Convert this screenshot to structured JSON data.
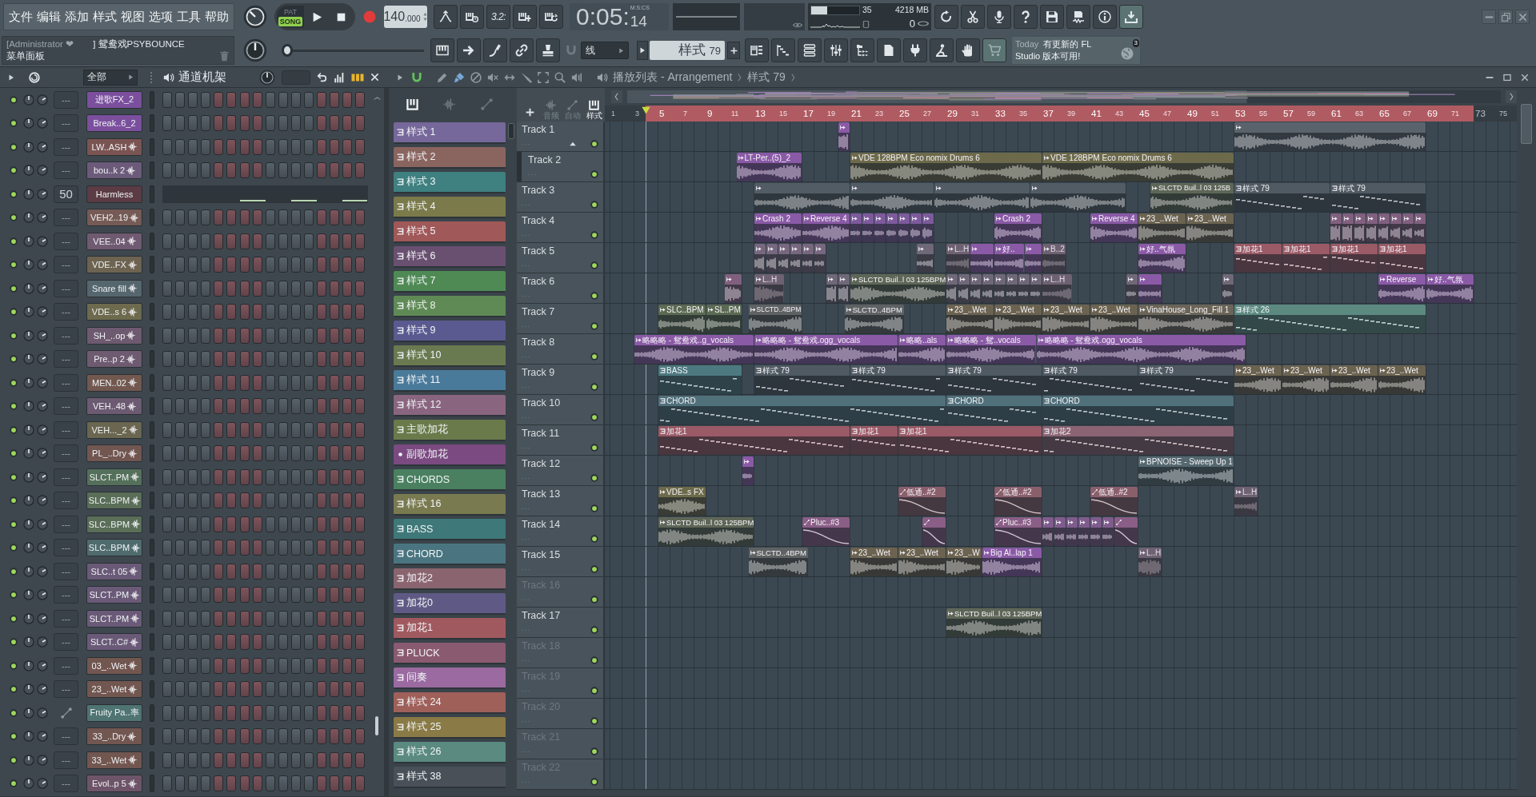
{
  "menu": [
    "文件",
    "编辑",
    "添加",
    "样式",
    "视图",
    "选项",
    "工具",
    "帮助"
  ],
  "hint": {
    "user": "[Administrator ❤",
    "project": "] 鸳鸯戏PSYBOUNCE",
    "panel": "菜单面板"
  },
  "transport": {
    "modes": [
      {
        "label": "PAT",
        "selected": false
      },
      {
        "label": "SONG",
        "selected": true
      }
    ],
    "tempo": "140",
    "tempo_decimals": ".000"
  },
  "toolbar": {
    "countdown": "3.2:"
  },
  "clock": {
    "label": "M:S:CS",
    "time": "0:05:",
    "centiseconds": "14"
  },
  "monitor": {
    "cpu": {
      "level": 0.33,
      "reading": "35"
    },
    "memory": "4218 MB",
    "polyphony": "0"
  },
  "master_pitch": {
    "level": 0
  },
  "snap": {
    "value": "线"
  },
  "pattern_selector": {
    "label": "样式",
    "number": "79"
  },
  "news": {
    "day": "Today",
    "lines": [
      "有更新的 FL",
      "Studio 版本可用!"
    ],
    "badge": "3"
  },
  "channel_rack": {
    "filter": "全部",
    "title": "通道机架",
    "channels": [
      {
        "name": "进歌FX_2",
        "kind": "plain",
        "color": "#7b4f9e",
        "mixer": "---",
        "on": true,
        "selected": false
      },
      {
        "name": "Break..6_2",
        "kind": "plain",
        "color": "#7b4f9e",
        "mixer": "---",
        "on": true,
        "selected": false
      },
      {
        "name": "LW..ASH",
        "kind": "sample",
        "color": "#7a5452",
        "mixer": "---",
        "on": true,
        "selected": false
      },
      {
        "name": "bou..k 2",
        "kind": "sample",
        "color": "#6c5a7a",
        "mixer": "---",
        "on": true,
        "selected": false
      },
      {
        "name": "Harmless",
        "kind": "instrument",
        "color": "#5b3b44",
        "mixer": "50",
        "on": true,
        "selected": false
      },
      {
        "name": "VEH2..19",
        "kind": "sample",
        "color": "#765a55",
        "mixer": "---",
        "on": true,
        "selected": false
      },
      {
        "name": "VEE..04",
        "kind": "sample",
        "color": "#705a72",
        "mixer": "---",
        "on": true,
        "selected": false
      },
      {
        "name": "VDE..FX",
        "kind": "sample",
        "color": "#6d6350",
        "mixer": "---",
        "on": true,
        "selected": false
      },
      {
        "name": "Snare fill",
        "kind": "sample",
        "color": "#56666e",
        "mixer": "---",
        "on": true,
        "selected": false
      },
      {
        "name": "VDE..s 6",
        "kind": "sample",
        "color": "#6d6a4e",
        "mixer": "---",
        "on": true,
        "selected": false
      },
      {
        "name": "SH_..op",
        "kind": "sample",
        "color": "#6e5a70",
        "mixer": "---",
        "on": true,
        "selected": false
      },
      {
        "name": "Pre..p 2",
        "kind": "sample",
        "color": "#6e5a71",
        "mixer": "---",
        "on": true,
        "selected": false
      },
      {
        "name": "MEN..02",
        "kind": "sample",
        "color": "#72584f",
        "mixer": "---",
        "on": true,
        "selected": false
      },
      {
        "name": "VEH..48",
        "kind": "sample",
        "color": "#6c5a72",
        "mixer": "---",
        "on": true,
        "selected": false
      },
      {
        "name": "VEH..._2",
        "kind": "sample",
        "color": "#6a6650",
        "mixer": "---",
        "on": true,
        "selected": false
      },
      {
        "name": "PL_..Dry",
        "kind": "sample",
        "color": "#725650",
        "mixer": "---",
        "on": true,
        "selected": false
      },
      {
        "name": "SLCT..PM",
        "kind": "sample",
        "color": "#55705a",
        "mixer": "---",
        "on": true,
        "selected": false
      },
      {
        "name": "SLC..BPM",
        "kind": "sample",
        "color": "#5a6e58",
        "mixer": "---",
        "on": true,
        "selected": false
      },
      {
        "name": "SLC..BPM",
        "kind": "sample",
        "color": "#5a6e58",
        "mixer": "---",
        "on": true,
        "selected": false
      },
      {
        "name": "SLC..BPM",
        "kind": "sample",
        "color": "#4f6b6e",
        "mixer": "---",
        "on": true,
        "selected": false
      },
      {
        "name": "SLC..t 05",
        "kind": "sample",
        "color": "#6a5a78",
        "mixer": "---",
        "on": true,
        "selected": false
      },
      {
        "name": "SLCT..PM",
        "kind": "sample",
        "color": "#6a5a78",
        "mixer": "---",
        "on": true,
        "selected": false
      },
      {
        "name": "SLCT..PM",
        "kind": "sample",
        "color": "#6a5a78",
        "mixer": "---",
        "on": true,
        "selected": false
      },
      {
        "name": "SLCT..C#",
        "kind": "sample",
        "color": "#6a5a78",
        "mixer": "---",
        "on": true,
        "selected": false
      },
      {
        "name": "03_..Wet",
        "kind": "sample",
        "color": "#725650",
        "mixer": "---",
        "on": true,
        "selected": false
      },
      {
        "name": "23_..Wet",
        "kind": "sample",
        "color": "#725650",
        "mixer": "---",
        "on": true,
        "selected": false
      },
      {
        "name": "Fruity Pa..率",
        "kind": "automation",
        "color": "#4f7472",
        "on": true,
        "selected": false
      },
      {
        "name": "33_..Dry",
        "kind": "sample",
        "color": "#725650",
        "mixer": "---",
        "on": true,
        "selected": false
      },
      {
        "name": "33_..Wet",
        "kind": "sample",
        "color": "#725650",
        "mixer": "---",
        "on": true,
        "selected": false
      },
      {
        "name": "Evol..p 5",
        "kind": "sample",
        "color": "#6e5468",
        "mixer": "---",
        "on": true,
        "selected": false
      }
    ]
  },
  "playlist": {
    "title": "播放列表 - Arrangement",
    "pattern": "样式 79",
    "picker_tabs": [
      {
        "kind": "keys",
        "selected": true
      },
      {
        "kind": "wave",
        "selected": false
      },
      {
        "kind": "curve",
        "selected": false
      }
    ],
    "patterns": [
      {
        "name": "样式 1",
        "kind": "notes",
        "color": "#76689a",
        "selected": false
      },
      {
        "name": "样式 2",
        "kind": "notes",
        "color": "#8a6560",
        "selected": false
      },
      {
        "name": "样式 3",
        "kind": "notes",
        "color": "#3f8080",
        "selected": false
      },
      {
        "name": "样式 4",
        "kind": "notes",
        "color": "#7a7a4a",
        "selected": false
      },
      {
        "name": "样式 5",
        "kind": "notes",
        "color": "#a05858",
        "selected": false
      },
      {
        "name": "样式 6",
        "kind": "notes",
        "color": "#6a5070",
        "selected": false
      },
      {
        "name": "样式 7",
        "kind": "notes",
        "color": "#4f8a55",
        "selected": false
      },
      {
        "name": "样式 8",
        "kind": "notes",
        "color": "#5f8a55",
        "selected": false
      },
      {
        "name": "样式 9",
        "kind": "notes",
        "color": "#5a5a90",
        "selected": false
      },
      {
        "name": "样式 10",
        "kind": "notes",
        "color": "#6a7a50",
        "selected": false
      },
      {
        "name": "样式 11",
        "kind": "notes",
        "color": "#4a7a9a",
        "selected": false
      },
      {
        "name": "样式 12",
        "kind": "notes",
        "color": "#8a6580",
        "selected": false
      },
      {
        "name": "主歌加花",
        "kind": "notes",
        "color": "#6a7a4a",
        "selected": false
      },
      {
        "name": "副歌加花",
        "kind": "dot",
        "color": "#7a4a80",
        "selected": false
      },
      {
        "name": "CHORDS",
        "kind": "notes",
        "color": "#4a8060",
        "selected": false
      },
      {
        "name": "样式 16",
        "kind": "notes",
        "color": "#7a7a50",
        "selected": false
      },
      {
        "name": "BASS",
        "kind": "notes",
        "color": "#3f7878",
        "selected": false
      },
      {
        "name": "CHORD",
        "kind": "notes",
        "color": "#4a7580",
        "selected": false
      },
      {
        "name": "加花2",
        "kind": "notes",
        "color": "#8a6570",
        "selected": false
      },
      {
        "name": "加花0",
        "kind": "notes",
        "color": "#5f5a85",
        "selected": false
      },
      {
        "name": "加花1",
        "kind": "notes",
        "color": "#a05a5f",
        "selected": false
      },
      {
        "name": "PLUCK",
        "kind": "notes",
        "color": "#8a5a70",
        "selected": false
      },
      {
        "name": "间奏",
        "kind": "notes",
        "color": "#9a6aa0",
        "selected": false
      },
      {
        "name": "样式 24",
        "kind": "notes",
        "color": "#a0605a",
        "selected": false
      },
      {
        "name": "样式 25",
        "kind": "notes",
        "color": "#8a7a45",
        "selected": false
      },
      {
        "name": "样式 26",
        "kind": "notes",
        "color": "#5a8a80",
        "selected": false
      },
      {
        "name": "样式 38",
        "kind": "notes",
        "color": "#4a5058",
        "selected": false
      }
    ],
    "clip_filters": [
      {
        "kind": "wave",
        "label": "音频",
        "selected": false
      },
      {
        "kind": "curve",
        "label": "自动",
        "selected": false
      },
      {
        "kind": "keys",
        "label": "样式",
        "selected": true
      }
    ],
    "ruler": {
      "bars": [
        "1",
        "3",
        "5",
        "7",
        "9",
        "11",
        "13",
        "15",
        "17",
        "19",
        "21",
        "23",
        "25",
        "27",
        "29",
        "31",
        "33",
        "35",
        "37",
        "39",
        "41",
        "43",
        "45",
        "47",
        "49",
        "51",
        "53",
        "55",
        "57",
        "59",
        "61",
        "63",
        "65",
        "67",
        "69",
        "71",
        "73",
        "75"
      ]
    },
    "tracks": [
      {
        "name": "Track 1",
        "on": true,
        "selected": false,
        "clips": [
          {
            "kind": "audio",
            "color": "#8a5aa6",
            "muted": false
          },
          {
            "kind": "audio",
            "color": "#5a636b",
            "muted": false
          }
        ]
      },
      {
        "name": "Track 2",
        "on": true,
        "selected": true,
        "clips": [
          {
            "kind": "audio",
            "name": "LT-Per..(5)_2",
            "color": "#8a5aa6",
            "muted": false
          },
          {
            "kind": "audio",
            "name": "VDE 128BPM Eco nomix Drums 6",
            "color": "#6d6a4b",
            "muted": false
          },
          {
            "kind": "audio",
            "name": "VDE 128BPM Eco nomix Drums 6",
            "color": "#6d6a4b",
            "muted": false
          }
        ]
      },
      {
        "name": "Track 3",
        "on": true,
        "selected": false,
        "clips": [
          {
            "kind": "audio",
            "color": "#525c64",
            "muted": false
          },
          {
            "kind": "audio",
            "color": "#525c64",
            "muted": false
          },
          {
            "kind": "audio",
            "color": "#525c64",
            "muted": false
          },
          {
            "kind": "audio",
            "color": "#525c64",
            "muted": false
          },
          {
            "kind": "audio",
            "name": "SLCTD Buil..l 03 125B",
            "color": "#5e6657",
            "muted": false
          },
          {
            "kind": "pattern",
            "name": "样式 79",
            "color": "#4f5a62",
            "muted": false
          },
          {
            "kind": "pattern",
            "name": "样式 79",
            "color": "#4f5a62",
            "muted": false
          }
        ]
      },
      {
        "name": "Track 4",
        "on": true,
        "selected": false,
        "clips": [
          {
            "kind": "audio",
            "name": "Crash 2",
            "color": "#8a5aa6",
            "muted": false
          },
          {
            "kind": "audio",
            "name": "Reverse 4",
            "color": "#8a5aa6",
            "muted": false
          },
          {
            "kind": "audio",
            "color": "#7d5a9c",
            "muted": false
          },
          {
            "kind": "audio",
            "color": "#7d5a9c",
            "muted": false
          },
          {
            "kind": "audio",
            "color": "#7d5a9c",
            "muted": false
          },
          {
            "kind": "audio",
            "color": "#7d5a9c",
            "muted": false
          },
          {
            "kind": "audio",
            "color": "#7d5a9c",
            "muted": false
          },
          {
            "kind": "audio",
            "color": "#7d5a9c",
            "muted": false
          },
          {
            "kind": "audio",
            "color": "#7d5a9c",
            "muted": false
          },
          {
            "kind": "audio",
            "name": "Crash 2",
            "color": "#8a5aa6",
            "muted": false
          },
          {
            "kind": "audio",
            "name": "Reverse 4",
            "color": "#8a5aa6",
            "muted": false
          },
          {
            "kind": "audio",
            "name": "23_..Wet",
            "color": "#6b6350",
            "muted": false
          },
          {
            "kind": "audio",
            "name": "23_..Wet",
            "color": "#6b6350",
            "muted": false
          },
          {
            "kind": "audio",
            "color": "#80607e",
            "muted": false
          },
          {
            "kind": "audio",
            "color": "#80607e",
            "muted": false
          },
          {
            "kind": "audio",
            "color": "#80607e",
            "muted": false
          },
          {
            "kind": "audio",
            "color": "#80607e",
            "muted": false
          },
          {
            "kind": "audio",
            "color": "#80607e",
            "muted": false
          },
          {
            "kind": "audio",
            "color": "#80607e",
            "muted": false
          },
          {
            "kind": "audio",
            "color": "#80607e",
            "muted": false
          },
          {
            "kind": "audio",
            "color": "#80607e",
            "muted": false
          }
        ]
      },
      {
        "name": "Track 5",
        "on": true,
        "selected": false,
        "clips": [
          {
            "kind": "audio",
            "color": "#77687f",
            "muted": false
          },
          {
            "kind": "audio",
            "color": "#77687f",
            "muted": false
          },
          {
            "kind": "audio",
            "color": "#77687f",
            "muted": false
          },
          {
            "kind": "audio",
            "color": "#77687f",
            "muted": false
          },
          {
            "kind": "audio",
            "color": "#77687f",
            "muted": false
          },
          {
            "kind": "audio",
            "color": "#77687f",
            "muted": false
          },
          {
            "kind": "audio",
            "color": "#6f6878",
            "muted": false
          },
          {
            "kind": "audio",
            "name": "L..H",
            "color": "#6e6272",
            "muted": true
          },
          {
            "kind": "audio",
            "color": "#8a5aa6",
            "muted": false
          },
          {
            "kind": "audio",
            "name": "好..",
            "color": "#8a5aa6",
            "muted": false
          },
          {
            "kind": "audio",
            "color": "#8a5aa6",
            "muted": false
          },
          {
            "kind": "audio",
            "name": "B..2",
            "color": "#6e6272",
            "muted": true
          },
          {
            "kind": "audio",
            "name": "好..气氛",
            "color": "#8a5aa6",
            "muted": false
          },
          {
            "kind": "pattern",
            "name": "加花1",
            "color": "#9a5a66",
            "muted": false
          },
          {
            "kind": "pattern",
            "name": "加花1",
            "color": "#9a5a66",
            "muted": false
          },
          {
            "kind": "pattern",
            "name": "加花1",
            "color": "#9a5a66",
            "muted": false
          },
          {
            "kind": "pattern",
            "name": "加花1",
            "color": "#9a5a66",
            "muted": false
          }
        ]
      },
      {
        "name": "Track 6",
        "on": true,
        "selected": false,
        "clips": [
          {
            "kind": "audio",
            "color": "#80607e",
            "muted": false
          },
          {
            "kind": "audio",
            "name": "L..H",
            "color": "#6e6272",
            "muted": true
          },
          {
            "kind": "audio",
            "color": "#6f6878",
            "muted": false
          },
          {
            "kind": "audio",
            "color": "#6f6878",
            "muted": false
          },
          {
            "kind": "audio",
            "name": "SLCTD Buil..l 03 125BPM",
            "color": "#5e6657",
            "muted": false
          },
          {
            "kind": "audio",
            "color": "#6f6878",
            "muted": false
          },
          {
            "kind": "audio",
            "color": "#6f6878",
            "muted": false
          },
          {
            "kind": "audio",
            "color": "#6f6878",
            "muted": false
          },
          {
            "kind": "audio",
            "color": "#6f6878",
            "muted": false
          },
          {
            "kind": "audio",
            "color": "#6f6878",
            "muted": false
          },
          {
            "kind": "audio",
            "color": "#6f6878",
            "muted": false
          },
          {
            "kind": "audio",
            "color": "#6f6878",
            "muted": false
          },
          {
            "kind": "audio",
            "color": "#6f6878",
            "muted": false
          },
          {
            "kind": "audio",
            "name": "L..H",
            "color": "#6e6272",
            "muted": true
          },
          {
            "kind": "audio",
            "color": "#6f6878",
            "muted": false
          },
          {
            "kind": "audio",
            "color": "#8a5aa6",
            "muted": false
          },
          {
            "kind": "audio",
            "color": "#6f6878",
            "muted": false
          },
          {
            "kind": "audio",
            "name": "Reverse",
            "color": "#8a5aa6",
            "muted": false
          },
          {
            "kind": "audio",
            "name": "好..气氛",
            "color": "#8a5aa6",
            "muted": false
          }
        ]
      },
      {
        "name": "Track 7",
        "on": true,
        "selected": false,
        "clips": [
          {
            "kind": "audio",
            "name": "SLC..BPM",
            "color": "#5b6a52",
            "muted": false
          },
          {
            "kind": "audio",
            "name": "SL..PM",
            "color": "#5b6a52",
            "muted": false
          },
          {
            "kind": "audio",
            "name": "SLCTD..4BPM",
            "color": "#5f6262",
            "muted": false
          },
          {
            "kind": "audio",
            "name": "SLCTD..4BPM",
            "color": "#5f6262",
            "muted": false
          },
          {
            "kind": "audio",
            "name": "23_..Wet",
            "color": "#6b6350",
            "muted": false
          },
          {
            "kind": "audio",
            "name": "23_..Wet",
            "color": "#6b6350",
            "muted": false
          },
          {
            "kind": "audio",
            "name": "23_..Wet",
            "color": "#6b6350",
            "muted": false
          },
          {
            "kind": "audio",
            "name": "23_..Wet",
            "color": "#6b6350",
            "muted": false
          },
          {
            "kind": "audio",
            "name": "VinaHouse_Long_Fill 1",
            "color": "#6b6558",
            "muted": false
          },
          {
            "kind": "pattern",
            "name": "样式 26",
            "color": "#5c8a80",
            "muted": false
          }
        ]
      },
      {
        "name": "Track 8",
        "on": true,
        "selected": false,
        "clips": [
          {
            "kind": "audio",
            "name": "略略略 - 鸳鸯戏..g_vocals",
            "color": "#8a5aa6",
            "muted": false
          },
          {
            "kind": "audio",
            "name": "略略略 - 鸳鸯戏.ogg_vocals",
            "color": "#8a5aa6",
            "muted": false
          },
          {
            "kind": "audio",
            "name": "略略..als",
            "color": "#8a5aa6",
            "muted": false
          },
          {
            "kind": "audio",
            "name": "略略略 - 鸳..vocals",
            "color": "#8a5aa6",
            "muted": false
          },
          {
            "kind": "audio",
            "name": "略略略 - 鸳鸯戏.ogg_vocals",
            "color": "#8a5aa6",
            "muted": false
          }
        ]
      },
      {
        "name": "Track 9",
        "on": true,
        "selected": false,
        "clips": [
          {
            "kind": "pattern",
            "name": "BASS",
            "color": "#4c7a80",
            "muted": false
          },
          {
            "kind": "pattern",
            "name": "样式 79",
            "color": "#4f5a62",
            "muted": false
          },
          {
            "kind": "pattern",
            "name": "样式 79",
            "color": "#4f5a62",
            "muted": false
          },
          {
            "kind": "pattern",
            "name": "样式 79",
            "color": "#4f5a62",
            "muted": false
          },
          {
            "kind": "pattern",
            "name": "样式 79",
            "color": "#4f5a62",
            "muted": false
          },
          {
            "kind": "pattern",
            "name": "样式 79",
            "color": "#4f5a62",
            "muted": false
          },
          {
            "kind": "audio",
            "name": "23_..Wet",
            "color": "#6b6350",
            "muted": false
          },
          {
            "kind": "audio",
            "name": "23_..Wet",
            "color": "#6b6350",
            "muted": false
          },
          {
            "kind": "audio",
            "name": "23_..Wet",
            "color": "#6b6350",
            "muted": false
          },
          {
            "kind": "audio",
            "name": "23_..Wet",
            "color": "#6b6350",
            "muted": false
          }
        ]
      },
      {
        "name": "Track 10",
        "on": true,
        "selected": false,
        "clips": [
          {
            "kind": "pattern",
            "name": "CHORD",
            "color": "#50707a",
            "muted": false
          },
          {
            "kind": "pattern",
            "name": "CHORD",
            "color": "#50707a",
            "muted": false
          },
          {
            "kind": "pattern",
            "name": "CHORD",
            "color": "#50707a",
            "muted": false
          }
        ]
      },
      {
        "name": "Track 11",
        "on": true,
        "selected": false,
        "clips": [
          {
            "kind": "pattern",
            "name": "加花1",
            "color": "#9a5a66",
            "muted": false
          },
          {
            "kind": "pattern",
            "name": "加花1",
            "color": "#9a5a66",
            "muted": false
          },
          {
            "kind": "pattern",
            "name": "加花1",
            "color": "#9a5a66",
            "muted": false
          },
          {
            "kind": "pattern",
            "name": "加花2",
            "color": "#8a6472",
            "muted": false
          }
        ]
      },
      {
        "name": "Track 12",
        "on": true,
        "selected": false,
        "clips": [
          {
            "kind": "audio",
            "color": "#8a5aa6",
            "muted": false
          },
          {
            "kind": "audio",
            "name": "BPNOISE - Sweep Up 1",
            "color": "#55686f",
            "muted": false
          }
        ]
      },
      {
        "name": "Track 13",
        "on": true,
        "selected": false,
        "clips": [
          {
            "kind": "audio",
            "name": "VDE..s FX",
            "color": "#6d6a4b",
            "muted": false
          },
          {
            "kind": "automation",
            "name": "低通..#2",
            "color": "#8a5f6c",
            "muted": false
          },
          {
            "kind": "automation",
            "name": "低通..#2",
            "color": "#8a5f6c",
            "muted": false
          },
          {
            "kind": "automation",
            "name": "低通..#2",
            "color": "#8a5f6c",
            "muted": false
          },
          {
            "kind": "audio",
            "name": "L..H",
            "color": "#6e6272",
            "muted": true
          }
        ]
      },
      {
        "name": "Track 14",
        "on": true,
        "selected": false,
        "clips": [
          {
            "kind": "audio",
            "name": "SLCTD Buil..l 03 125BPM",
            "color": "#5e6657",
            "muted": false
          },
          {
            "kind": "automation",
            "name": "Pluc..#3",
            "color": "#8a5e86",
            "muted": false
          },
          {
            "kind": "automation",
            "color": "#8a5e86",
            "muted": false
          },
          {
            "kind": "automation",
            "name": "Pluc..#3",
            "color": "#8a5e86",
            "muted": false
          },
          {
            "kind": "audio",
            "color": "#7e5c8c",
            "muted": false
          },
          {
            "kind": "audio",
            "color": "#7e5c8c",
            "muted": false
          },
          {
            "kind": "audio",
            "color": "#7e5c8c",
            "muted": false
          },
          {
            "kind": "audio",
            "color": "#7e5c8c",
            "muted": false
          },
          {
            "kind": "audio",
            "color": "#7e5c8c",
            "muted": false
          },
          {
            "kind": "audio",
            "color": "#7e5c8c",
            "muted": false
          },
          {
            "kind": "automation",
            "color": "#8a5e86",
            "muted": false
          }
        ]
      },
      {
        "name": "Track 15",
        "on": true,
        "selected": false,
        "clips": [
          {
            "kind": "audio",
            "name": "SLCTD..4BPM",
            "color": "#5f6262",
            "muted": false
          },
          {
            "kind": "audio",
            "name": "23_..Wet",
            "color": "#6b6350",
            "muted": false
          },
          {
            "kind": "audio",
            "name": "23_..Wet",
            "color": "#6b6350",
            "muted": false
          },
          {
            "kind": "audio",
            "name": "23_..W",
            "color": "#6b6350",
            "muted": false
          },
          {
            "kind": "audio",
            "name": "Big Al..lap 1",
            "color": "#8a5aa6",
            "muted": false
          },
          {
            "kind": "audio",
            "name": "L..H",
            "color": "#6e6272",
            "muted": true
          }
        ]
      },
      {
        "name": "Track 16",
        "on": true,
        "selected": false
      },
      {
        "name": "Track 17",
        "on": true,
        "selected": false,
        "clips": [
          {
            "kind": "audio",
            "name": "SLCTD Buil..l 03 125BPM",
            "color": "#5e6657",
            "muted": false
          }
        ]
      },
      {
        "name": "Track 18",
        "on": true,
        "selected": false
      },
      {
        "name": "Track 19",
        "on": true,
        "selected": false
      },
      {
        "name": "Track 20",
        "on": true,
        "selected": false
      },
      {
        "name": "Track 21",
        "on": true,
        "selected": false
      },
      {
        "name": "Track 22",
        "on": true,
        "selected": false
      }
    ]
  }
}
